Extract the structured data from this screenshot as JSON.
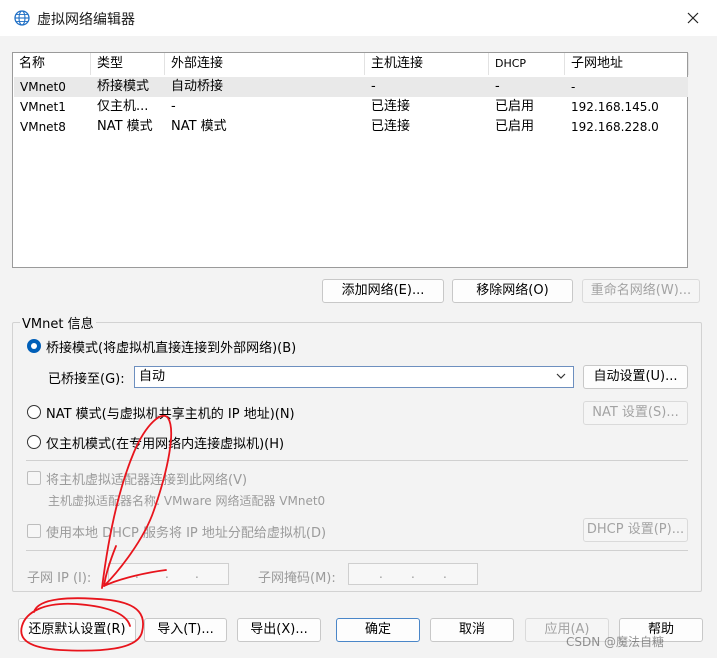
{
  "window": {
    "title": "虚拟网络编辑器",
    "close_label": "✕"
  },
  "table": {
    "columns": [
      "名称",
      "类型",
      "外部连接",
      "主机连接",
      "DHCP",
      "子网地址"
    ],
    "rows": [
      [
        "VMnet0",
        "桥接模式",
        "自动桥接",
        "-",
        "-",
        "-"
      ],
      [
        "VMnet1",
        "仅主机...",
        "-",
        "已连接",
        "已启用",
        "192.168.145.0"
      ],
      [
        "VMnet8",
        "NAT 模式",
        "NAT 模式",
        "已连接",
        "已启用",
        "192.168.228.0"
      ]
    ],
    "selected_row": 0
  },
  "list_buttons": {
    "add": "添加网络(E)...",
    "remove": "移除网络(O)",
    "rename": "重命名网络(W)..."
  },
  "vmnet_info": {
    "legend": "VMnet 信息",
    "bridged_label": "桥接模式(将虚拟机直接连接到外部网络)(B)",
    "bridged_to_label": "已桥接至(G):",
    "bridged_to_value": "自动",
    "auto_settings": "自动设置(U)...",
    "nat_label": "NAT 模式(与虚拟机共享主机的 IP 地址)(N)",
    "nat_settings": "NAT 设置(S)...",
    "hostonly_label": "仅主机模式(在专用网络内连接虚拟机)(H)",
    "connect_adapter_label": "将主机虚拟适配器连接到此网络(V)",
    "adapter_name_label": "主机虚拟适配器名称: VMware 网络适配器 VMnet0",
    "dhcp_label": "使用本地 DHCP 服务将 IP 地址分配给虚拟机(D)",
    "dhcp_settings": "DHCP 设置(P)...",
    "subnet_ip_label": "子网 IP (I):",
    "subnet_mask_label": "子网掩码(M):",
    "ip_dot": "."
  },
  "footer": {
    "restore": "还原默认设置(R)",
    "import": "导入(T)...",
    "export": "导出(X)...",
    "ok": "确定",
    "cancel": "取消",
    "apply": "应用(A)",
    "help": "帮助"
  },
  "watermark": "CSDN @魔法自糖",
  "colors": {
    "accent": "#005fb8",
    "annotation": "#e8141c",
    "selection": "#e9e9e9"
  }
}
